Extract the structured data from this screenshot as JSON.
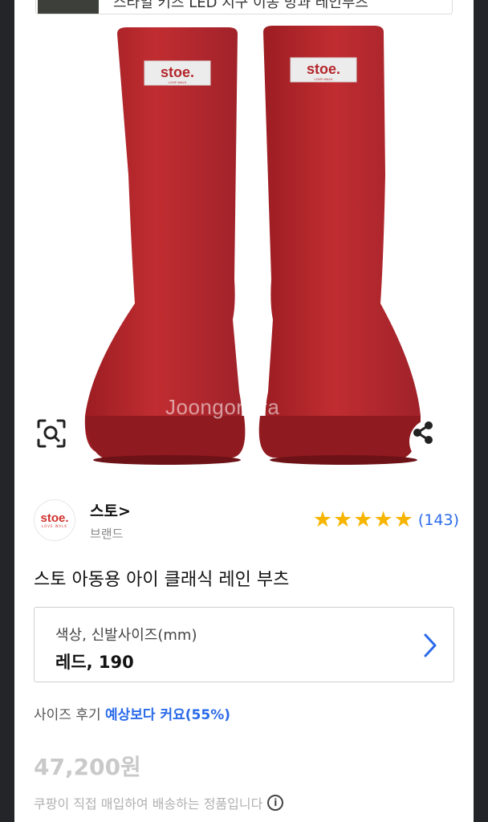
{
  "top_banner": {
    "text": "스타일 키즈 LED 지구 이동 방과 레인부츠"
  },
  "hero": {
    "watermark": "Joongonara",
    "boot_tag_text": "stoe.",
    "boot_tag_sub": "LOVE WALK"
  },
  "brand": {
    "logo_text": "stoe.",
    "logo_sub": "LOVE WALK",
    "name": "스토>",
    "type": "브랜드",
    "stars": [
      "★",
      "★",
      "★",
      "★",
      "★"
    ],
    "rating_value": 5,
    "review_count": "(143)"
  },
  "product": {
    "title": "스토 아동용 아이 클래식 레인 부츠"
  },
  "option": {
    "label": "색상, 신발사이즈(mm)",
    "value": "레드, 190"
  },
  "size_review": {
    "prefix": "사이즈 후기 ",
    "highlight": "예상보다 커요(55%)"
  },
  "price": "47,200원",
  "notice": {
    "text": "쿠팡이 직접 매입하여 배송하는 정품입니다",
    "icon": "info-icon"
  },
  "colors": {
    "accent": "#2a6ae9",
    "star": "#f7b500",
    "boot": "#b3262b"
  }
}
